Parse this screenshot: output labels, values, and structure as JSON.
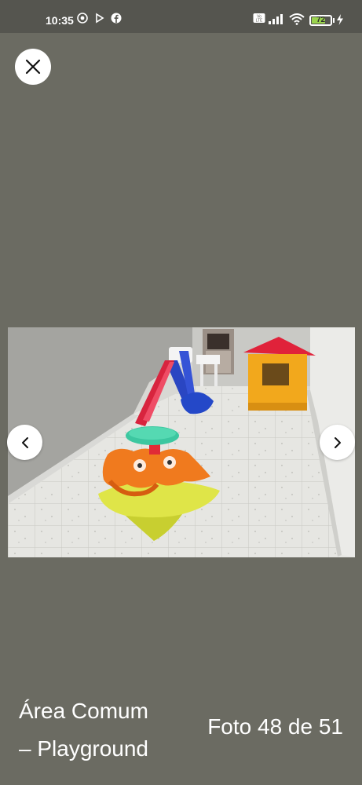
{
  "status_bar": {
    "time": "10:35",
    "battery_level": "72",
    "battery_fraction": 0.72,
    "icons": [
      "chrome-icon",
      "play-icon",
      "facebook-icon",
      "volte-icon",
      "signal-icon",
      "wifi-icon",
      "battery-icon",
      "charging-bolt-icon"
    ]
  },
  "viewer": {
    "close_icon": "close-icon",
    "prev_icon": "chevron-left-icon",
    "next_icon": "chevron-right-icon",
    "caption_line1": "Área Comum",
    "caption_line2": "– Playground",
    "counter": "Foto 48 de 51"
  },
  "colors": {
    "background": "#6b6b62",
    "status_bar": "#55554f",
    "battery_fill": "#9ad34e"
  }
}
